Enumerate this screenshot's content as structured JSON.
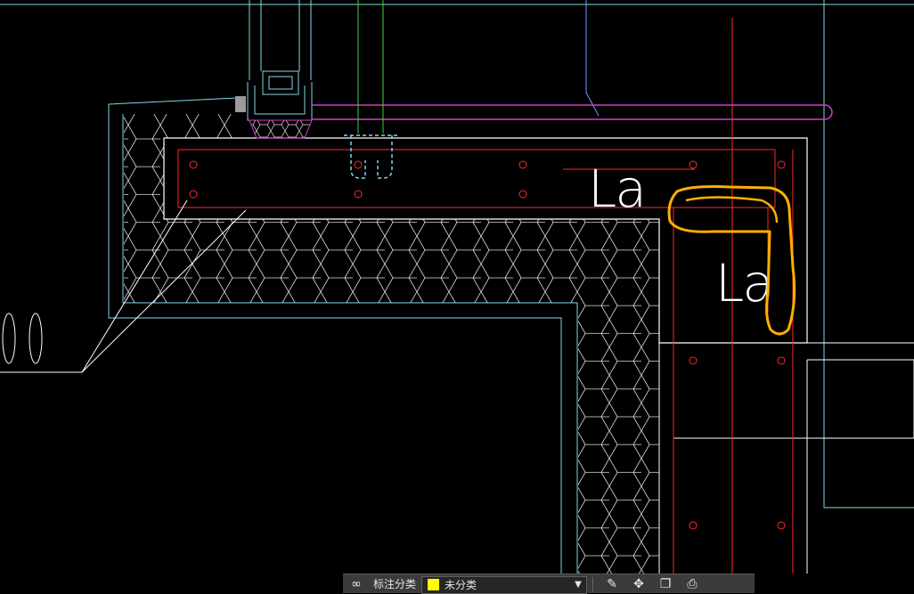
{
  "drawing": {
    "dimension_labels": [
      "La",
      "La"
    ],
    "colors": {
      "background": "#000000",
      "cyan": "#7fd8e8",
      "white": "#ffffff",
      "red": "#ff2a2a",
      "green": "#3cd23c",
      "magenta": "#d23cd2",
      "blue": "#6ea0ff",
      "markup_orange": "#ffb000"
    }
  },
  "toolbar": {
    "label": "标注分类",
    "category_value": "未分类",
    "category_color": "#ffff00",
    "icons": [
      "annotation-style-icon",
      "edit-icon",
      "move-icon",
      "copy-icon",
      "print-icon"
    ]
  }
}
